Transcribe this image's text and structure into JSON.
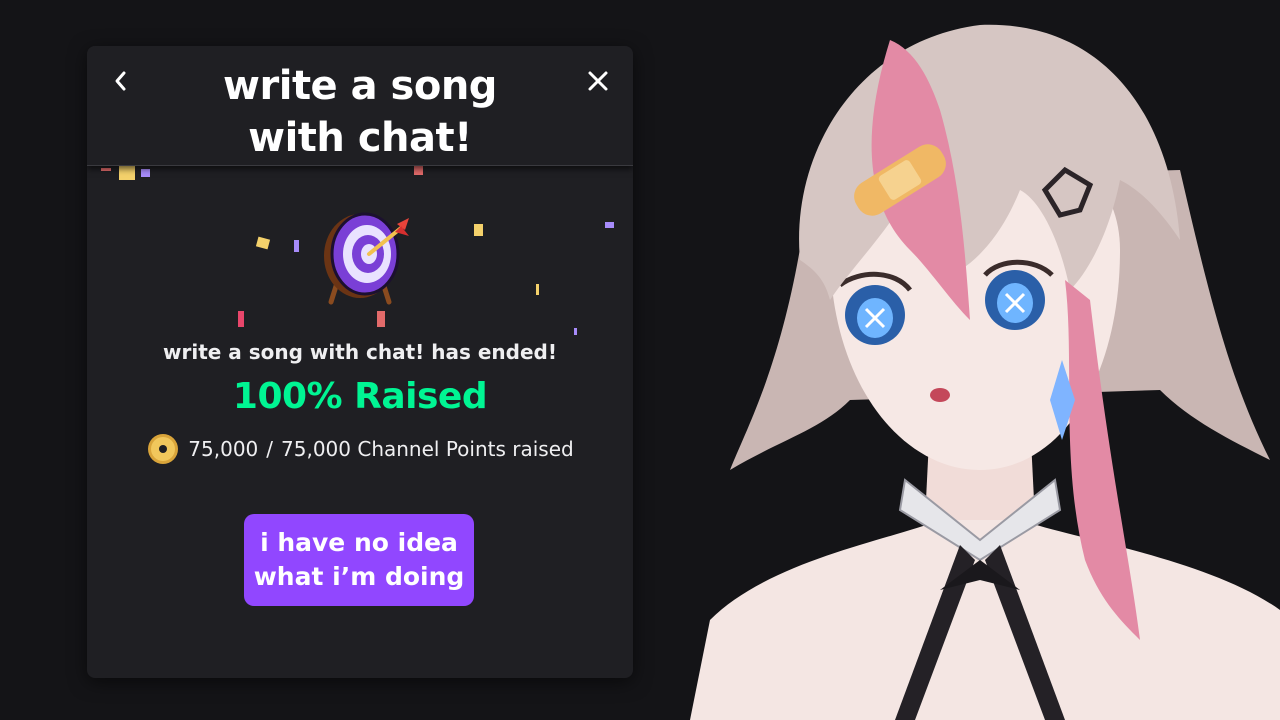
{
  "panel": {
    "title_line1": "write a song",
    "title_line2": "with chat!",
    "back_icon": "chevron-left-icon",
    "close_icon": "close-icon",
    "goal_icon": "target-icon",
    "ended_text": "write a song with chat! has ended!",
    "raised_text": "100% Raised",
    "coin_icon": "channel-points-icon",
    "points_current": "75,000",
    "points_separator": "/",
    "points_total": "75,000 Channel Points raised"
  },
  "overlay_caption": {
    "line1": "i have no idea",
    "line2": "what i’m doing"
  },
  "colors": {
    "background": "#141417",
    "panel": "#1f1f23",
    "accent_green": "#00f593",
    "caption_purple": "#9147ff"
  }
}
